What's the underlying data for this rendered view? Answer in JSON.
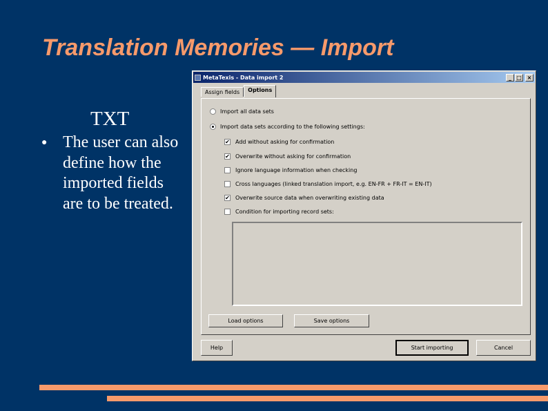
{
  "slide": {
    "title": "Translation Memories — Import",
    "subhead": "TXT",
    "bullet_marker": "●",
    "bullet_text": "The user can also define how the imported fields are to be treated.",
    "accent_color": "#f79a6b",
    "background_color": "#003366"
  },
  "dialog": {
    "title": "MetaTexis - Data import 2",
    "window_buttons": {
      "minimize": "_",
      "maximize": "□",
      "close": "×"
    },
    "tabs": [
      {
        "label": "Assign fields",
        "active": false
      },
      {
        "label": "Options",
        "active": true
      }
    ],
    "radios": [
      {
        "label": "Import all data sets",
        "checked": false
      },
      {
        "label": "Import data sets according to the following settings:",
        "checked": true
      }
    ],
    "checkboxes": [
      {
        "label": "Add without asking for confirmation",
        "checked": true,
        "mark": "✔"
      },
      {
        "label": "Overwrite without asking for confirmation",
        "checked": true,
        "mark": "✔"
      },
      {
        "label": "Ignore language information when checking",
        "checked": false,
        "mark": ""
      },
      {
        "label": "Cross languages (linked translation import, e.g. EN-FR + FR-IT = EN-IT)",
        "checked": false,
        "mark": ""
      },
      {
        "label": "Overwrite source data when overwriting existing data",
        "checked": true,
        "mark": "✔"
      },
      {
        "label": "Condition for importing record sets:",
        "checked": false,
        "mark": ""
      }
    ],
    "condition_value": "",
    "buttons": {
      "load_options": "Load options",
      "save_options": "Save options",
      "help": "Help",
      "start_importing": "Start importing",
      "cancel": "Cancel"
    }
  }
}
